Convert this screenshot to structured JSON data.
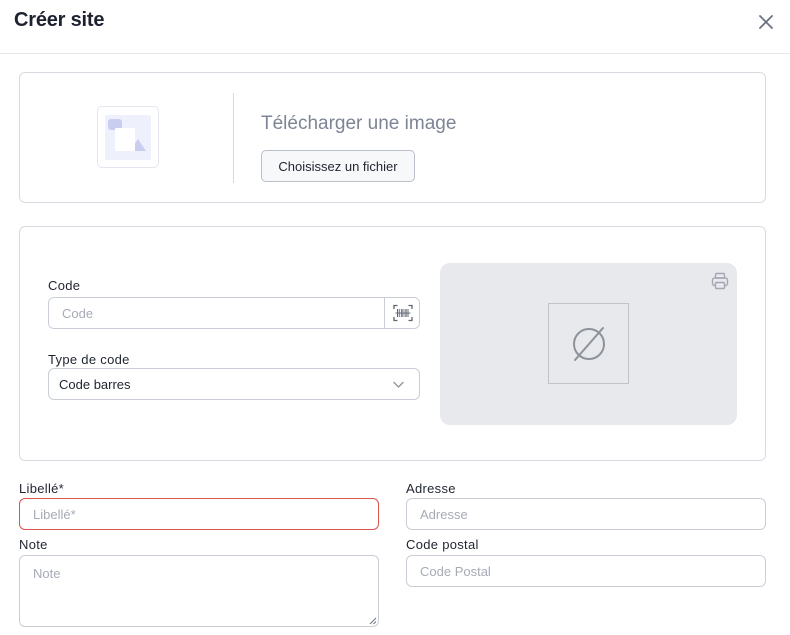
{
  "dialog": {
    "title": "Créer site"
  },
  "upload": {
    "title": "Télécharger une image",
    "button_label": "Choisissez un fichier"
  },
  "code_section": {
    "code_label": "Code",
    "code_placeholder": "Code",
    "code_value": "",
    "type_label": "Type de code",
    "type_selected": "Code barres",
    "preview_state": "empty"
  },
  "form": {
    "libelle_label": "Libellé*",
    "libelle_placeholder": "Libellé*",
    "adresse_label": "Adresse",
    "adresse_placeholder": "Adresse",
    "note_label": "Note",
    "note_placeholder": "Note",
    "postal_label": "Code postal",
    "postal_placeholder": "Code Postal"
  },
  "colors": {
    "error_border": "#d9534f",
    "muted_text": "#7d8494",
    "preview_bg": "#e7e9ed"
  },
  "icons": {
    "close": "close-icon",
    "image": "image-placeholder-icon",
    "scan": "barcode-scan-icon",
    "chevron": "chevron-down-icon",
    "print": "printer-icon",
    "empty": "empty-set-icon"
  }
}
